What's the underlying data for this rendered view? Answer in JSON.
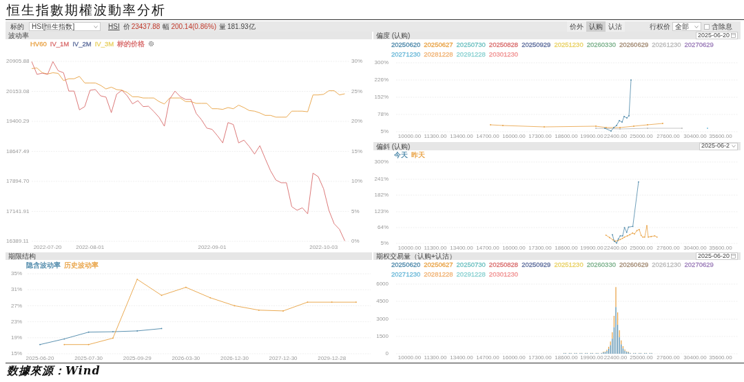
{
  "title": "恒生指數期權波動率分析",
  "toolbar": {
    "underlying_label": "标的",
    "underlying_select": "HSI[恒生指数]",
    "code_link": "HSI",
    "price_label": "价",
    "price": "23437.88",
    "change_label": "幅",
    "change": "200.14(0.86%)",
    "volume_label": "量",
    "volume": "181.93亿",
    "option_filters": [
      {
        "label": "价外",
        "selected": false
      },
      {
        "label": "认购",
        "selected": true
      },
      {
        "label": "认沽",
        "selected": false
      }
    ],
    "strike_label": "行权价",
    "strike_select": "全部",
    "dividend_checkbox": {
      "label": "含除息",
      "checked": false
    }
  },
  "volatility_panel": {
    "header": "波动率",
    "legend": [
      {
        "kind": "volatility_series"
      },
      {
        "kind": "label",
        "label": "IV_1M",
        "color": "#d86a6a"
      },
      {
        "kind": "label",
        "label": "IV_2M",
        "color": "#5a6a9a"
      },
      {
        "kind": "label",
        "label": "IV_3M",
        "color": "#e8d060"
      },
      {
        "kind": "price_series"
      }
    ],
    "chart_data": {
      "type": "line",
      "grid": true,
      "categories": [
        null,
        null,
        null,
        "2022-07-20",
        null,
        null,
        null,
        null,
        null,
        null,
        null,
        "2022-08-01",
        null,
        null,
        null,
        null,
        null,
        null,
        null,
        null,
        null,
        null,
        null,
        null,
        null,
        null,
        null,
        null,
        null,
        null,
        null,
        null,
        null,
        null,
        "2022-09-01",
        null,
        null,
        null,
        null,
        null,
        null,
        null,
        null,
        null,
        null,
        null,
        null,
        null,
        null,
        null,
        null,
        null,
        null,
        null,
        null,
        "2022-10-03",
        null,
        null,
        null,
        null
      ],
      "ylim": [
        16389.11,
        20905.88
      ],
      "yticks": [
        {
          "value": 20905.88,
          "label": "20905.88"
        },
        {
          "value": 20153.08,
          "label": "20153.08"
        },
        {
          "value": 19400.29,
          "label": "19400.29"
        },
        {
          "value": 18647.49,
          "label": "18647.49"
        },
        {
          "value": 17894.7,
          "label": "17894.70"
        },
        {
          "value": 17141.91,
          "label": "17141.91"
        },
        {
          "value": 16389.11,
          "label": "16389.11"
        }
      ],
      "y2lim": [
        0,
        30
      ],
      "y2ticks": [
        {
          "value": 30,
          "label": "30%"
        },
        {
          "value": 25,
          "label": "25%"
        },
        {
          "value": 20,
          "label": "20%"
        },
        {
          "value": 15,
          "label": "15%"
        },
        {
          "value": 10,
          "label": "10%"
        },
        {
          "value": 5,
          "label": "5%"
        },
        {
          "value": 0,
          "label": "0%"
        }
      ],
      "series": [
        {
          "name": "HV60",
          "color": "#e8a040",
          "axis": "y2",
          "values": [
            28.8,
            28.9,
            28.1,
            27.9,
            28.1,
            28.0,
            26.8,
            27.1,
            27.1,
            27.5,
            26.4,
            26.4,
            26.4,
            26.0,
            25.4,
            25.7,
            25.3,
            25.2,
            24.8,
            24.1,
            24.1,
            23.9,
            23.9,
            23.9,
            23.3,
            22.9,
            23.9,
            23.9,
            23.9,
            23.3,
            23.3,
            23.0,
            23.0,
            23.0,
            22.1,
            22.1,
            22.0,
            22.3,
            22.1,
            22.7,
            22.3,
            21.8,
            21.7,
            21.4,
            21.0,
            21.0,
            20.7,
            20.7,
            20.7,
            21.7,
            21.7,
            21.7,
            21.6,
            24.4,
            24.4,
            24.5,
            25.1,
            25.1,
            24.4,
            24.6
          ]
        },
        {
          "name": "标的价格",
          "color": "#d86a6a",
          "values": [
            20900,
            20580,
            20610,
            20580,
            20900,
            20670,
            20620,
            20160,
            20160,
            19690,
            19770,
            20180,
            20200,
            20040,
            20010,
            19620,
            20080,
            20180,
            20040,
            19840,
            19920,
            19770,
            19780,
            19650,
            19500,
            19280,
            19960,
            20160,
            20020,
            19950,
            19950,
            19600,
            19440,
            19230,
            19200,
            19040,
            18860,
            19370,
            19320,
            18860,
            18930,
            18770,
            18580,
            18790,
            18470,
            18160,
            17930,
            17860,
            17860,
            17260,
            17170,
            17230,
            17080,
            18100,
            18010,
            17710,
            17170,
            16830,
            16690,
            16400
          ]
        }
      ]
    }
  },
  "skew_panel": {
    "header": "偏度  (认购)",
    "date": "2025-06-20",
    "legend": [
      {
        "label": "20250620",
        "color": "#4a86a8"
      },
      {
        "label": "20250627",
        "color": "#e8a040"
      },
      {
        "label": "20250730",
        "color": "#6cc0c0"
      },
      {
        "label": "20250828",
        "color": "#d86a6a"
      },
      {
        "label": "20250929",
        "color": "#5a6a9a"
      },
      {
        "label": "20251230",
        "color": "#e8d060"
      },
      {
        "label": "20260330",
        "color": "#7ab08a"
      },
      {
        "label": "20260629",
        "color": "#a08870"
      },
      {
        "label": "20261230",
        "color": "#b8b8b8"
      },
      {
        "label": "20270629",
        "color": "#9a7ab8"
      },
      {
        "label": "20271230",
        "color": "#6ab8d8"
      },
      {
        "label": "20281228",
        "color": "#f0b070"
      },
      {
        "label": "20291228",
        "color": "#88d0d0"
      },
      {
        "label": "20301230",
        "color": "#f09090"
      }
    ],
    "y_axis_labels": [
      "300%",
      "226%",
      "152%",
      "78%",
      "5%"
    ],
    "x_axis_labels": [
      "10000.00",
      "11300.00",
      "13400.00",
      "14700.00",
      "16000.00",
      "17300.00",
      "18600.00",
      "19900.00",
      "22400.00",
      "25000.00",
      "27600.00",
      "30400.00",
      "35600.00"
    ]
  },
  "slope_panel": {
    "header": "偏斜  (认购)",
    "date_select": "2025-06-2",
    "legend": [
      {
        "label": "今天",
        "color": "#4a86a8"
      },
      {
        "label": "昨天",
        "color": "#e8a040"
      }
    ],
    "y_axis_labels": [
      "300%",
      "241%",
      "182%",
      "123%",
      "64%",
      "5%"
    ],
    "x_axis_labels": [
      "10000.00",
      "11300.00",
      "13400.00",
      "14700.00",
      "16000.00",
      "17300.00",
      "18600.00",
      "19900.00",
      "22400.00",
      "25000.00",
      "27600.00",
      "30400.00",
      "35600.00"
    ]
  },
  "term_panel": {
    "header": "期限结构",
    "chart_data": {
      "type": "line",
      "grid": true,
      "categories": [
        "2025-06-20",
        null,
        "2025-07-30",
        null,
        "2025-09-29",
        null,
        "2026-03-30",
        null,
        "2026-12-30",
        null,
        "2027-12-30",
        null,
        "2029-12-28",
        null
      ],
      "ylim": [
        15,
        35
      ],
      "yticks": [
        {
          "value": 35,
          "label": "35%"
        },
        {
          "value": 31,
          "label": "31%"
        },
        {
          "value": 27,
          "label": "27%"
        },
        {
          "value": 23,
          "label": "23%"
        },
        {
          "value": 19,
          "label": "19%"
        },
        {
          "value": 15,
          "label": "15%"
        }
      ],
      "series": [
        {
          "name": "隐含波动率",
          "color": "#4a86a8",
          "values": [
            17.3,
            18.7,
            20.4,
            20.5,
            20.7,
            21.3,
            null,
            null,
            null,
            null,
            null,
            null,
            null,
            null
          ]
        },
        {
          "name": "历史波动率",
          "color": "#e8a040",
          "values": [
            null,
            17.3,
            17.3,
            18.9,
            33.6,
            29.6,
            31.6,
            29.0,
            27.0,
            25.9,
            25.7,
            27.9,
            27.9,
            27.9
          ]
        }
      ]
    }
  },
  "volume_panel": {
    "header": "期权交易量（认购+认沽）",
    "date": "2025-06-20",
    "legend": [
      {
        "label": "20250620",
        "color": "#4a86a8"
      },
      {
        "label": "20250627",
        "color": "#e8a040"
      },
      {
        "label": "20250730",
        "color": "#6cc0c0"
      },
      {
        "label": "20250828",
        "color": "#d86a6a"
      },
      {
        "label": "20250929",
        "color": "#5a6a9a"
      },
      {
        "label": "20251230",
        "color": "#e8d060"
      },
      {
        "label": "20260330",
        "color": "#7ab08a"
      },
      {
        "label": "20260629",
        "color": "#a08870"
      },
      {
        "label": "20261230",
        "color": "#b8b8b8"
      },
      {
        "label": "20270629",
        "color": "#9a7ab8"
      },
      {
        "label": "20271230",
        "color": "#6ab8d8"
      },
      {
        "label": "20281228",
        "color": "#f0b070"
      },
      {
        "label": "20291228",
        "color": "#88d0d0"
      },
      {
        "label": "20301230",
        "color": "#f09090"
      }
    ],
    "y_axis_labels": [
      "6000",
      "4500",
      "3000",
      "1500",
      "0"
    ],
    "x_axis_labels": [
      "10000.00",
      "11300.00",
      "13400.00",
      "14700.00",
      "16000.00",
      "17300.00",
      "18600.00",
      "19900.00",
      "22400.00",
      "25000.00",
      "27600.00",
      "30400.00",
      "35600.00"
    ]
  },
  "footer": "数據來源：Wind"
}
